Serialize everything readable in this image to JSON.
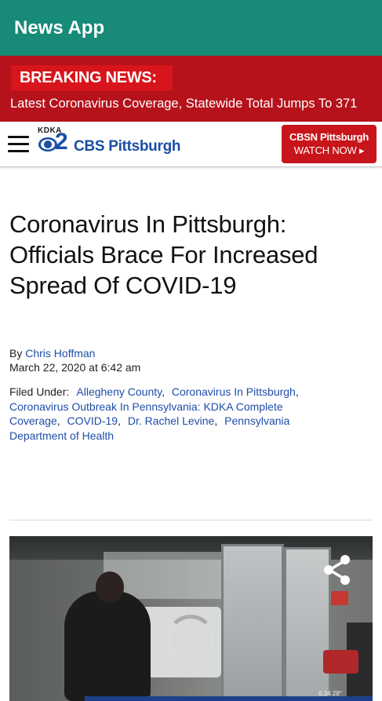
{
  "app": {
    "title": "News App"
  },
  "colors": {
    "appbar": "#178a78",
    "breaking": "#b5121b",
    "link": "#1f4ea8",
    "cbsn_button": "#c8141b"
  },
  "breaking": {
    "badge": "BREAKING NEWS:",
    "headline": "Latest Coronavirus Coverage, Statewide Total Jumps To 371"
  },
  "site": {
    "menu_icon": "hamburger-menu-icon",
    "logo_kdka": "KDKA",
    "logo_channel": "2",
    "logo_name": "CBS Pittsburgh",
    "cbsn_button": {
      "line1": "CBSN Pittsburgh",
      "line2": "WATCH NOW ▸"
    }
  },
  "article": {
    "headline": "Coronavirus In Pittsburgh: Officials Brace For Increased Spread Of COVID-19",
    "by_prefix": "By",
    "author": "Chris Hoffman",
    "date": "March 22, 2020 at 6:42 am",
    "filed_under_label": "Filed Under:",
    "tags": [
      "Allegheny County",
      "Coronavirus In Pittsburgh",
      "Coronavirus Outbreak In Pennsylvania: KDKA Complete Coverage",
      "COVID-19",
      "Dr. Rachel Levine",
      "Pennsylvania Department of Health"
    ]
  },
  "video": {
    "share_icon": "share-icon",
    "loading_icon": "loading-spinner-icon",
    "overlay_time": "6:34  28°"
  }
}
